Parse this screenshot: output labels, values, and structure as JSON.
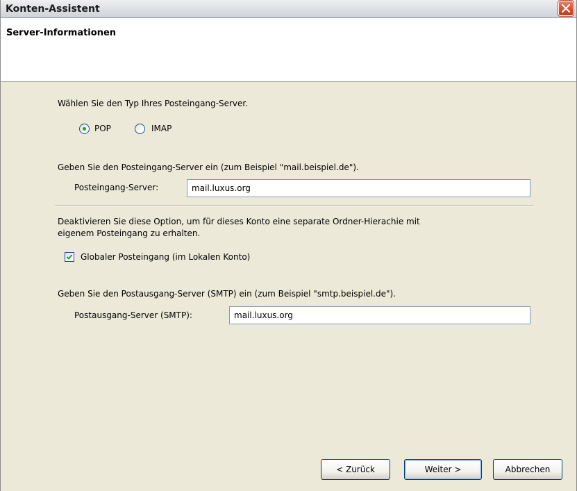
{
  "window": {
    "title": "Konten-Assistent",
    "close_icon": "close-x-icon"
  },
  "page": {
    "title": "Server-Informationen"
  },
  "server_type": {
    "prompt": "Wählen Sie den Typ Ihres Posteingang-Server.",
    "options": [
      {
        "label": "POP",
        "selected": true
      },
      {
        "label": "IMAP",
        "selected": false
      }
    ]
  },
  "incoming": {
    "prompt": "Geben Sie den Posteingang-Server ein (zum Beispiel \"mail.beispiel.de\").",
    "label": "Posteingang-Server:",
    "value": "mail.luxus.org"
  },
  "global_inbox": {
    "description_line1": "Deaktivieren Sie diese Option, um für dieses Konto eine separate Ordner-Hierachie mit",
    "description_line2": "eigenem Posteingang zu erhalten.",
    "checkbox_label": "Globaler Posteingang (im Lokalen Konto)",
    "checked": true
  },
  "outgoing": {
    "prompt": "Geben Sie den Postausgang-Server (SMTP) ein (zum Beispiel \"smtp.beispiel.de\").",
    "label": "Postausgang-Server (SMTP):",
    "value": "mail.luxus.org"
  },
  "buttons": {
    "back": "< Zurück",
    "next": "Weiter >",
    "cancel": "Abbrechen"
  },
  "colors": {
    "window_bg": "#ece9d8",
    "close_red": "#d9542f",
    "radio_green": "#21a121",
    "field_border": "#7f9db9"
  }
}
